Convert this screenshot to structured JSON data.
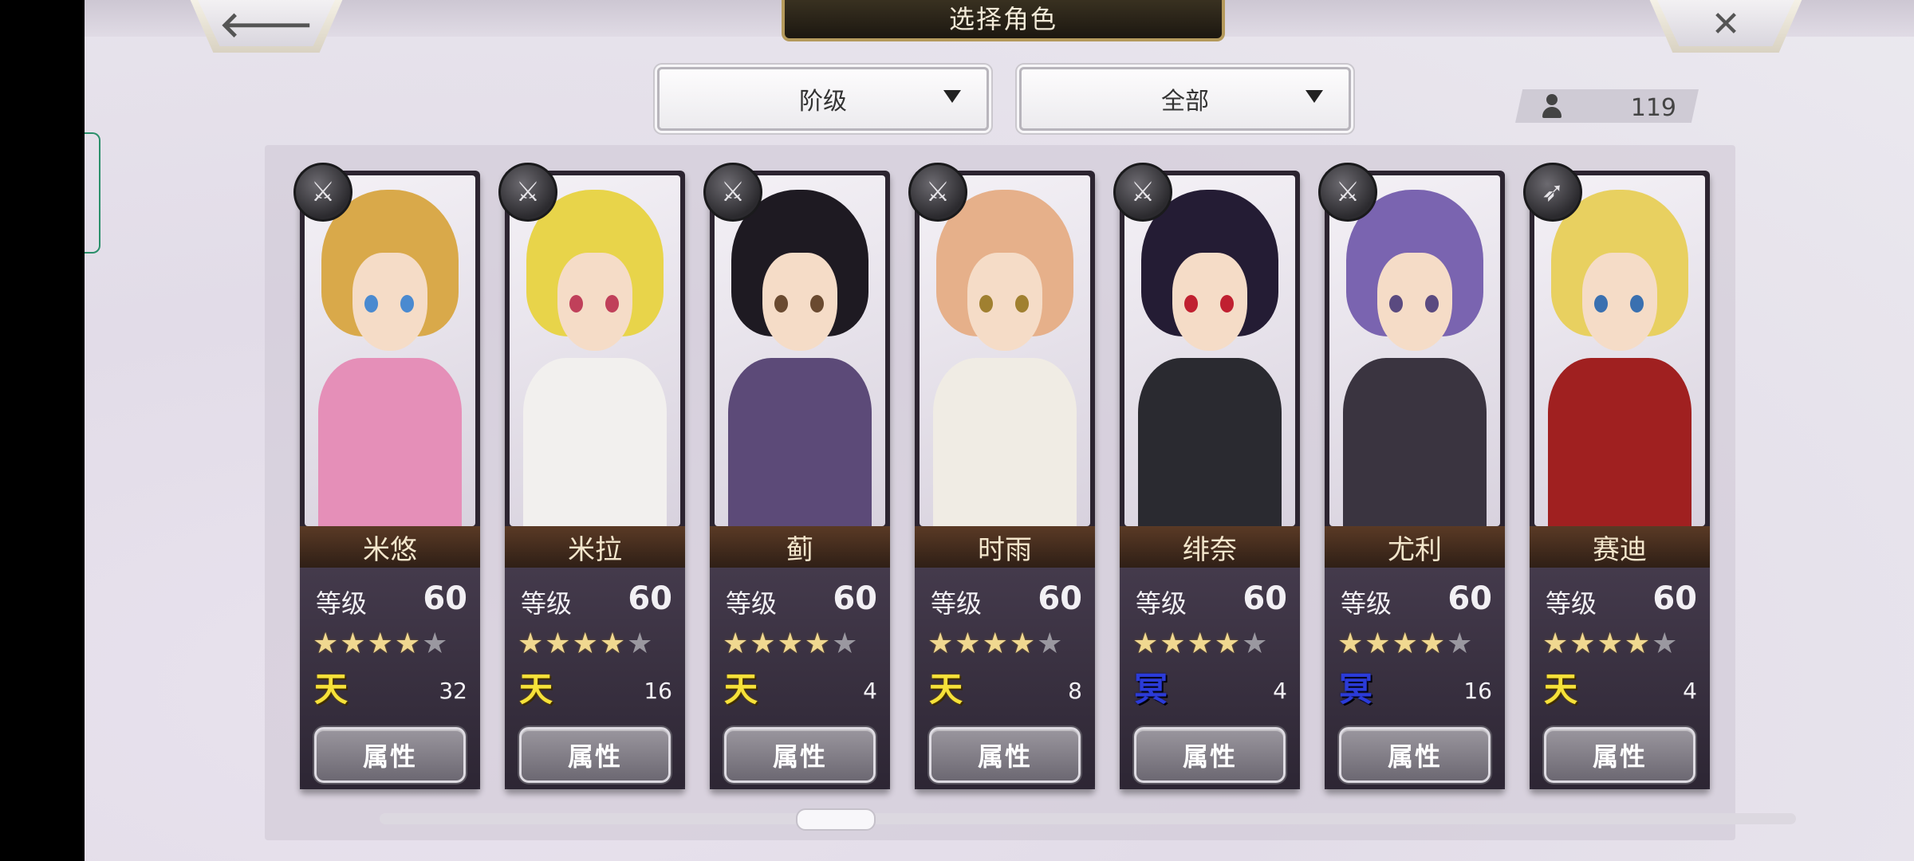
{
  "header": {
    "title": "选择角色",
    "back_glyph": "🡐",
    "close_glyph": "✕"
  },
  "filters": {
    "rank_label": "阶级",
    "scope_label": "全部"
  },
  "roster": {
    "count": "119"
  },
  "buttons": {
    "attr_label": "属性",
    "level_label": "等级"
  },
  "characters": [
    {
      "name": "米悠",
      "level": "60",
      "stars": 4,
      "max_stars": 5,
      "rank_glyph": "天",
      "rank_color": "gold",
      "rank_count": "32",
      "weapon": "sword",
      "hair": "#d9a94a",
      "body": "#e58fb8",
      "eyes": "#4a8ad0"
    },
    {
      "name": "米拉",
      "level": "60",
      "stars": 4,
      "max_stars": 5,
      "rank_glyph": "天",
      "rank_color": "gold",
      "rank_count": "16",
      "weapon": "sword",
      "hair": "#e8d44a",
      "body": "#f2f0ee",
      "eyes": "#c0405a"
    },
    {
      "name": "蓟",
      "level": "60",
      "stars": 4,
      "max_stars": 5,
      "rank_glyph": "天",
      "rank_color": "gold",
      "rank_count": "4",
      "weapon": "katana",
      "hair": "#1e1a22",
      "body": "#5c4a78",
      "eyes": "#6a4a30"
    },
    {
      "name": "时雨",
      "level": "60",
      "stars": 4,
      "max_stars": 5,
      "rank_glyph": "天",
      "rank_color": "gold",
      "rank_count": "8",
      "weapon": "katana",
      "hair": "#e6b08a",
      "body": "#f0ece4",
      "eyes": "#a08030"
    },
    {
      "name": "绯奈",
      "level": "60",
      "stars": 4,
      "max_stars": 5,
      "rank_glyph": "冥",
      "rank_color": "blue",
      "rank_count": "4",
      "weapon": "katana",
      "hair": "#241c34",
      "body": "#2a2a30",
      "eyes": "#c02030"
    },
    {
      "name": "尤利",
      "level": "60",
      "stars": 4,
      "max_stars": 5,
      "rank_glyph": "冥",
      "rank_color": "blue",
      "rank_count": "16",
      "weapon": "katana",
      "hair": "#7a64b0",
      "body": "#3a3440",
      "eyes": "#5a4a80"
    },
    {
      "name": "赛迪",
      "level": "60",
      "stars": 4,
      "max_stars": 5,
      "rank_glyph": "天",
      "rank_color": "gold",
      "rank_count": "4",
      "weapon": "spear",
      "hair": "#e8d060",
      "body": "#a02020",
      "eyes": "#3a70b0"
    }
  ],
  "colors": {
    "title_plate": "#2a2418",
    "accent_gold": "#b59a5c",
    "rank_gold": "#f6e23a",
    "rank_blue": "#2b3bd8"
  },
  "scroll": {
    "position": 0.3
  }
}
